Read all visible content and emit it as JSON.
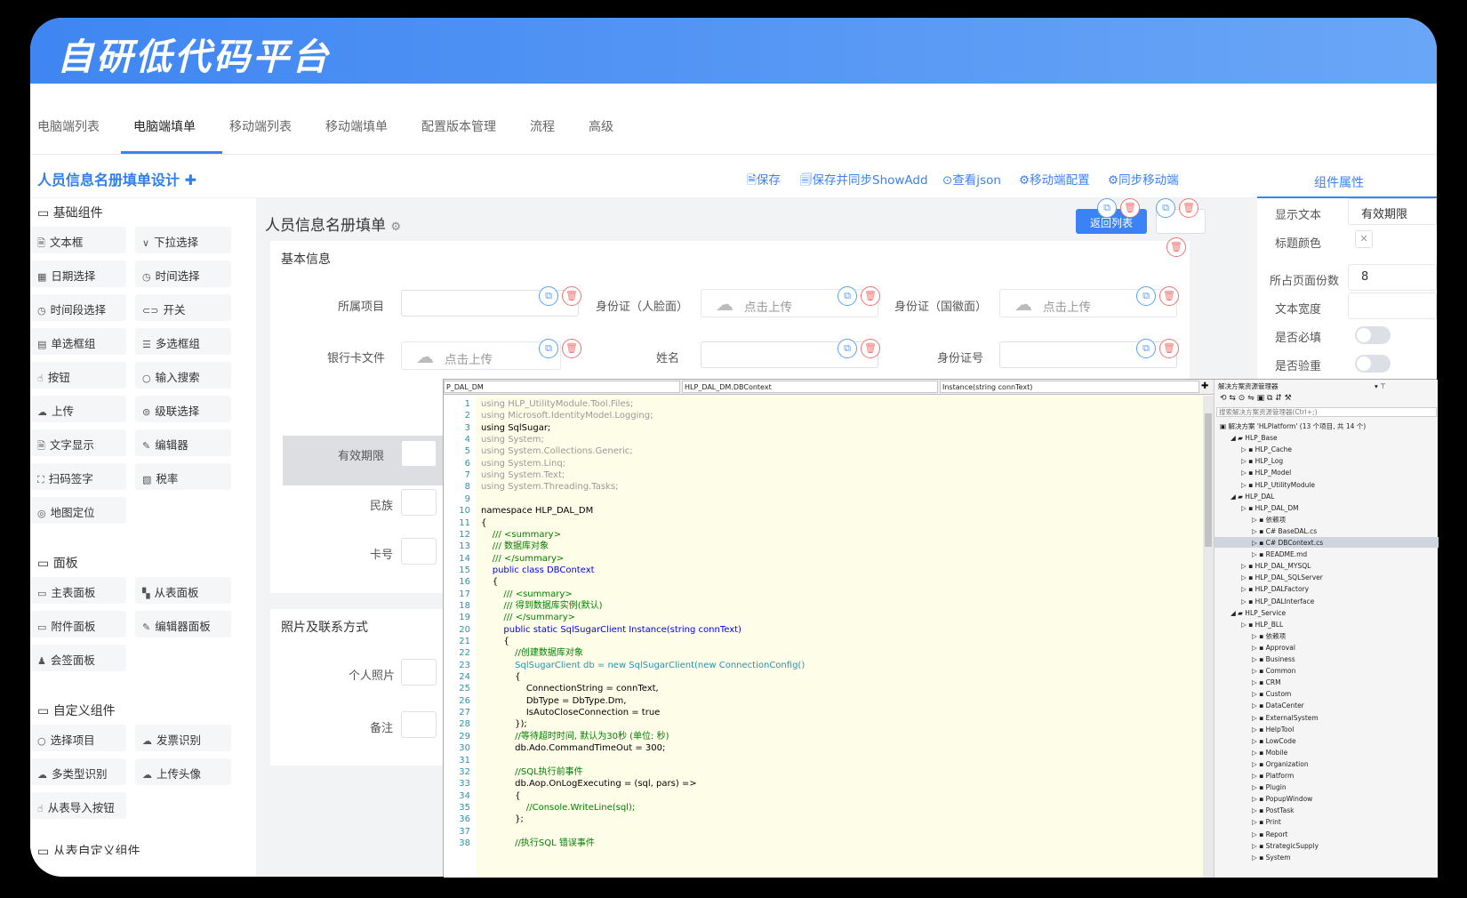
{
  "header": {
    "title": "自研低代码平台"
  },
  "tabs": [
    "电脑端列表",
    "电脑端填单",
    "移动端列表",
    "移动端填单",
    "配置版本管理",
    "流程",
    "高级"
  ],
  "design_bar": {
    "title": "人员信息名册填单设计",
    "actions": [
      "保存",
      "保存并同步ShowAdd",
      "查看json",
      "移动端配置",
      "同步移动端"
    ]
  },
  "props_tab": "组件属性",
  "left_panel": {
    "basic_title": "基础组件",
    "basic": [
      "文本框",
      "下拉选择",
      "日期选择",
      "时间选择",
      "时间段选择",
      "开关",
      "单选框组",
      "多选框组",
      "按钮",
      "输入搜索",
      "上传",
      "级联选择",
      "文字显示",
      "编辑器",
      "扫码签字",
      "税率",
      "地图定位"
    ],
    "panel_title": "面板",
    "panels": [
      "主表面板",
      "从表面板",
      "附件面板",
      "编辑器面板",
      "会签面板"
    ],
    "custom_title": "自定义组件",
    "custom": [
      "选择项目",
      "发票识别",
      "多类型识别",
      "上传头像",
      "从表导入按钮"
    ],
    "cut_title": "从表自定义组件"
  },
  "form": {
    "title": "人员信息名册填单",
    "back_label": "返回列表",
    "section1": "基本信息",
    "section2": "照片及联系方式",
    "upload_text": "点击上传",
    "labels": {
      "project": "所属项目",
      "id_front": "身份证（人脸面）",
      "id_back": "身份证（国徽面）",
      "bank_card": "银行卡文件",
      "name": "姓名",
      "id_no": "身份证号",
      "valid": "有效期限",
      "ethnic": "民族",
      "card_no": "卡号",
      "photo": "个人照片",
      "remark": "备注"
    }
  },
  "props": {
    "display_text_label": "显示文本",
    "display_text_value": "有效期限",
    "title_color_label": "标题颜色",
    "pages_label": "所占页面份数",
    "pages_value": "8",
    "width_label": "文本宽度",
    "required_label": "是否必填",
    "dup_label": "是否验重"
  },
  "ide": {
    "dd1": "P_DAL_DM",
    "dd2": "HLP_DAL_DM.DBContext",
    "dd3": "Instance(string connText)",
    "code": [
      {
        "n": "1",
        "t": "using HLP_UtilityModule.Tool.Files;",
        "c": "#999"
      },
      {
        "n": "2",
        "t": "using Microsoft.IdentityModel.Logging;",
        "c": "#999"
      },
      {
        "n": "3",
        "t": "using SqlSugar;",
        "c": "#000"
      },
      {
        "n": "4",
        "t": "using System;",
        "c": "#999"
      },
      {
        "n": "5",
        "t": "using System.Collections.Generic;",
        "c": "#999"
      },
      {
        "n": "6",
        "t": "using System.Linq;",
        "c": "#999"
      },
      {
        "n": "7",
        "t": "using System.Text;",
        "c": "#999"
      },
      {
        "n": "8",
        "t": "using System.Threading.Tasks;",
        "c": "#999"
      },
      {
        "n": "9",
        "t": "",
        "c": "#000"
      },
      {
        "n": "10",
        "t": "namespace HLP_DAL_DM",
        "c": "#000"
      },
      {
        "n": "11",
        "t": "{",
        "c": "#000"
      },
      {
        "n": "12",
        "t": "    /// <summary>",
        "c": "#008000"
      },
      {
        "n": "13",
        "t": "    /// 数据库对象",
        "c": "#008000"
      },
      {
        "n": "14",
        "t": "    /// </summary>",
        "c": "#008000"
      },
      {
        "n": "15",
        "t": "    public class DBContext",
        "c": "#0000ff"
      },
      {
        "n": "16",
        "t": "    {",
        "c": "#000"
      },
      {
        "n": "17",
        "t": "        /// <summary>",
        "c": "#008000"
      },
      {
        "n": "18",
        "t": "        /// 得到数据库实例(默认)",
        "c": "#008000"
      },
      {
        "n": "19",
        "t": "        /// </summary>",
        "c": "#008000"
      },
      {
        "n": "20",
        "t": "        public static SqlSugarClient Instance(string connText)",
        "c": "#0000ff"
      },
      {
        "n": "21",
        "t": "        {",
        "c": "#000"
      },
      {
        "n": "22",
        "t": "            //创建数据库对象",
        "c": "#008000"
      },
      {
        "n": "23",
        "t": "            SqlSugarClient db = new SqlSugarClient(new ConnectionConfig()",
        "c": "#2b91af"
      },
      {
        "n": "24",
        "t": "            {",
        "c": "#000"
      },
      {
        "n": "25",
        "t": "                ConnectionString = connText,",
        "c": "#000"
      },
      {
        "n": "26",
        "t": "                DbType = DbType.Dm,",
        "c": "#000"
      },
      {
        "n": "27",
        "t": "                IsAutoCloseConnection = true",
        "c": "#000"
      },
      {
        "n": "28",
        "t": "            });",
        "c": "#000"
      },
      {
        "n": "29",
        "t": "            //等待超时时间, 默认为30秒 (单位: 秒)",
        "c": "#008000"
      },
      {
        "n": "30",
        "t": "            db.Ado.CommandTimeOut = 300;",
        "c": "#000"
      },
      {
        "n": "31",
        "t": "",
        "c": "#000"
      },
      {
        "n": "32",
        "t": "            //SQL执行前事件",
        "c": "#008000"
      },
      {
        "n": "33",
        "t": "            db.Aop.OnLogExecuting = (sql, pars) =>",
        "c": "#000"
      },
      {
        "n": "34",
        "t": "            {",
        "c": "#000"
      },
      {
        "n": "35",
        "t": "                //Console.WriteLine(sql);",
        "c": "#008000"
      },
      {
        "n": "36",
        "t": "            };",
        "c": "#000"
      },
      {
        "n": "37",
        "t": "",
        "c": "#000"
      },
      {
        "n": "38",
        "t": "            //执行SQL 错误事件",
        "c": "#008000"
      }
    ],
    "sol_title": "解决方案资源管理器",
    "sol_search": "搜索解决方案资源管理器(Ctrl+;)",
    "tree": [
      {
        "t": "解决方案 'HLPlatform' (13 个项目, 共 14 个)",
        "lv": 0
      },
      {
        "t": "HLP_Base",
        "lv": 1
      },
      {
        "t": "HLP_Cache",
        "lv": 2
      },
      {
        "t": "HLP_Log",
        "lv": 2
      },
      {
        "t": "HLP_Model",
        "lv": 2
      },
      {
        "t": "HLP_UtilityModule",
        "lv": 2
      },
      {
        "t": "HLP_DAL",
        "lv": 1
      },
      {
        "t": "HLP_DAL_DM",
        "lv": 2
      },
      {
        "t": "依赖项",
        "lv": 3
      },
      {
        "t": "C# BaseDAL.cs",
        "lv": 3
      },
      {
        "t": "C# DBContext.cs",
        "lv": 3
      },
      {
        "t": "README.md",
        "lv": 3
      },
      {
        "t": "HLP_DAL_MYSQL",
        "lv": 2
      },
      {
        "t": "HLP_DAL_SQLServer",
        "lv": 2
      },
      {
        "t": "HLP_DALFactory",
        "lv": 2
      },
      {
        "t": "HLP_DALInterface",
        "lv": 2
      },
      {
        "t": "HLP_Service",
        "lv": 1
      },
      {
        "t": "HLP_BLL",
        "lv": 2
      },
      {
        "t": "依赖项",
        "lv": 3
      },
      {
        "t": "Approval",
        "lv": 3
      },
      {
        "t": "Business",
        "lv": 3
      },
      {
        "t": "Common",
        "lv": 3
      },
      {
        "t": "CRM",
        "lv": 3
      },
      {
        "t": "Custom",
        "lv": 3
      },
      {
        "t": "DataCenter",
        "lv": 3
      },
      {
        "t": "ExternalSystem",
        "lv": 3
      },
      {
        "t": "HelpTool",
        "lv": 3
      },
      {
        "t": "LowCode",
        "lv": 3
      },
      {
        "t": "Mobile",
        "lv": 3
      },
      {
        "t": "Organization",
        "lv": 3
      },
      {
        "t": "Platform",
        "lv": 3
      },
      {
        "t": "Plugin",
        "lv": 3
      },
      {
        "t": "PopupWindow",
        "lv": 3
      },
      {
        "t": "PostTask",
        "lv": 3
      },
      {
        "t": "Print",
        "lv": 3
      },
      {
        "t": "Report",
        "lv": 3
      },
      {
        "t": "StrategicSupply",
        "lv": 3
      },
      {
        "t": "System",
        "lv": 3
      }
    ]
  },
  "colors": {
    "accent": "#3b82f6",
    "danger": "#f07373"
  }
}
